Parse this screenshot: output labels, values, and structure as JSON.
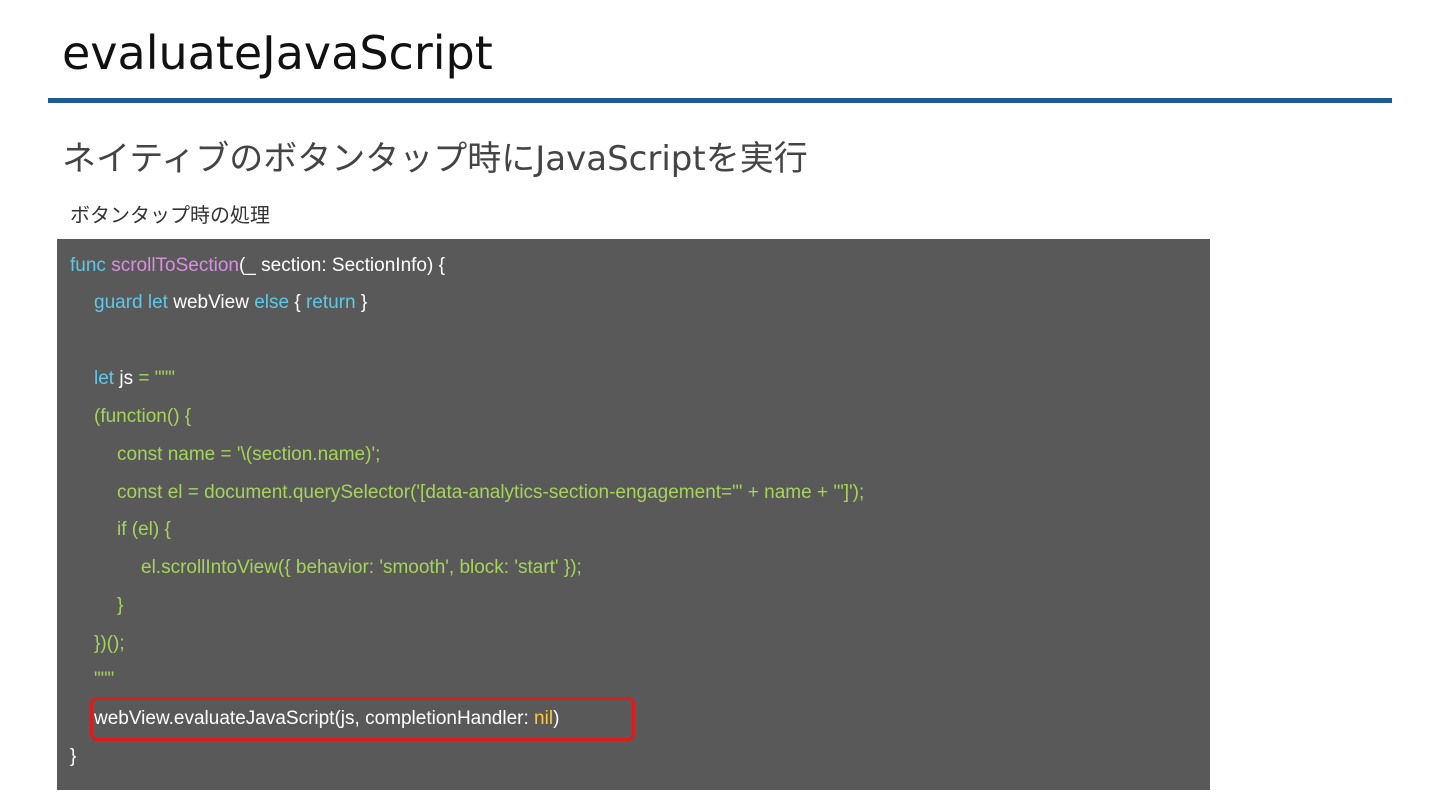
{
  "slide": {
    "title": "evaluateJavaScript",
    "heading": "ネイティブのボタンタップ時にJavaScriptを実行",
    "caption": "ボタンタップ時の処理"
  },
  "code": {
    "line1": {
      "kw_func": "func",
      "name": "scrollToSection",
      "rest": "(_ section: SectionInfo) {"
    },
    "line2": {
      "kw_guard_let": "guard let",
      "var": " webView ",
      "kw_else": "else",
      "brace_open": " { ",
      "kw_return": "return",
      "brace_close": " }"
    },
    "line4": {
      "kw_let": "let",
      "var": " js ",
      "assign": "= \"\"\""
    },
    "line5": {
      "text": "(function() {"
    },
    "line6": {
      "text": "const name = '\\(section.name)';"
    },
    "line7": {
      "text": "const el = document.querySelector('[data-analytics-section-engagement=\"' + name + '\"]');"
    },
    "line8": {
      "text": "if (el) {"
    },
    "line9": {
      "text": "el.scrollIntoView({ behavior: 'smooth', block: 'start' });"
    },
    "line10": {
      "text": "}"
    },
    "line11": {
      "text": "})();"
    },
    "line12": {
      "text": "\"\"\""
    },
    "line13": {
      "call": "webView.evaluateJavaScript(js, completionHandler: ",
      "nil": "nil",
      "close": ")"
    },
    "line14": {
      "text": "}"
    }
  },
  "colors": {
    "title_rule": "#1d5a96",
    "code_background": "#595959",
    "keyword": "#5ec8e8",
    "function_name": "#d98fe0",
    "string": "#a6d45a",
    "nil_literal": "#f7c948",
    "highlight_border": "#e01a1a"
  }
}
